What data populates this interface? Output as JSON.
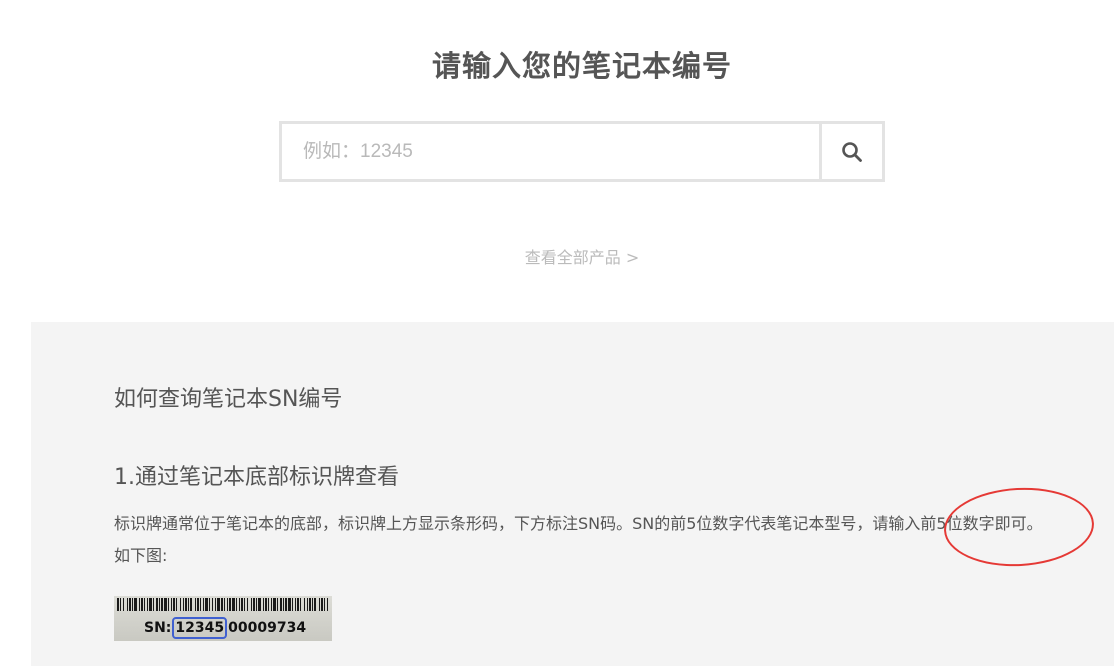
{
  "page": {
    "title": "请输入您的笔记本编号"
  },
  "search": {
    "placeholder": "例如：12345",
    "value": ""
  },
  "links": {
    "all_products": "查看全部产品 >"
  },
  "help": {
    "title": "如何查询笔记本SN编号",
    "step1_heading": "1.通过笔记本底部标识牌查看",
    "step1_desc": "标识牌通常位于笔记本的底部，标识牌上方显示条形码，下方标注SN码。SN的前5位数字代表笔记本型号，请输入前5位数字即可。如下图:"
  },
  "sn_label": {
    "prefix": "SN:",
    "model": "12345",
    "suffix": "00009734"
  },
  "icons": {
    "search": "search-icon",
    "annotation": "red-circle-annotation"
  },
  "colors": {
    "title": "#555555",
    "border": "#e3e3e3",
    "link": "#bbbbbb",
    "panel": "#f4f4f4",
    "annotation": "#e53935",
    "sn_highlight": "#4060d0"
  }
}
